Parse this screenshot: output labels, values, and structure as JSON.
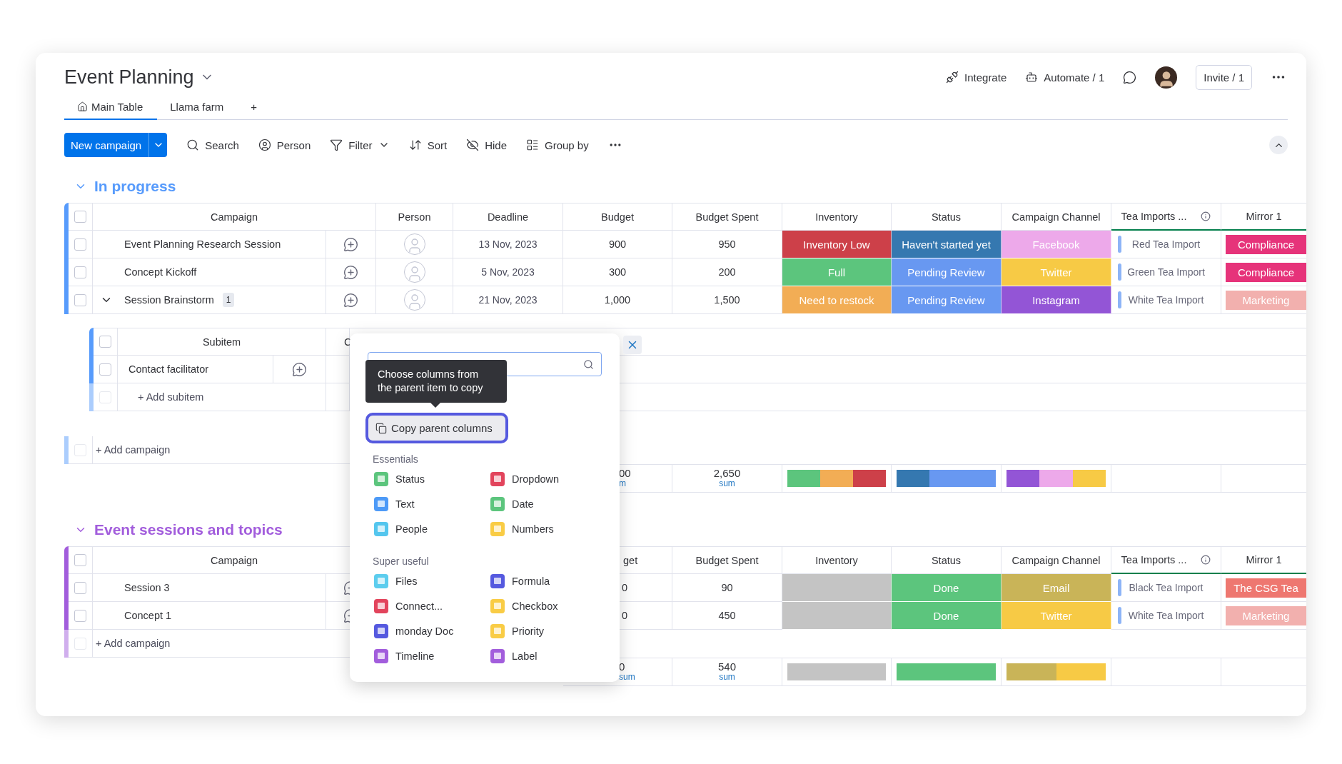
{
  "board": {
    "title": "Event Planning"
  },
  "header_actions": [
    {
      "label": "Integrate",
      "kind": "integrate"
    },
    {
      "label": "Automate / 1",
      "kind": "automate"
    }
  ],
  "invite": "Invite / 1",
  "tabs": [
    {
      "label": "Main Table",
      "selected": true,
      "kind": "home"
    },
    {
      "label": "Llama farm",
      "selected": false
    }
  ],
  "add_tab": "+",
  "toolbar": {
    "primary": "New campaign",
    "items": [
      {
        "label": "Search",
        "kind": "search"
      },
      {
        "label": "Person",
        "kind": "person"
      },
      {
        "label": "Filter",
        "kind": "filter"
      },
      {
        "label": "Sort",
        "kind": "sort"
      },
      {
        "label": "Hide",
        "kind": "hide"
      },
      {
        "label": "Group by",
        "kind": "group"
      }
    ]
  },
  "groups": [
    {
      "title": "In progress",
      "color": "#579bfc",
      "expanded": true,
      "all_checked": false,
      "columns": {
        "campaign": "Campaign",
        "person": "Person",
        "deadline": "Deadline",
        "budget": "Budget",
        "spent": "Budget Spent",
        "inventory": "Inventory",
        "status": "Status",
        "channel": "Campaign Channel",
        "tea": "Tea Imports ...",
        "mirror": "Mirror 1"
      },
      "rows": [
        {
          "name": "Event Planning Research Session",
          "checked": false,
          "person": {
            "assigned": false
          },
          "deadline": "13 Nov, 2023",
          "budget": "900",
          "spent": "950",
          "inventory": {
            "label": "Inventory Low",
            "color": "#cd4049"
          },
          "status": {
            "label": "Haven't started yet",
            "color": "#3578b0"
          },
          "channel": {
            "label": "Facebook",
            "color": "#eda9ea"
          },
          "tea": "Red Tea Import",
          "mirror": {
            "label": "Compliance",
            "color": "#e6337a"
          }
        },
        {
          "name": "Concept Kickoff",
          "checked": false,
          "person": {
            "assigned": false
          },
          "deadline": "5 Nov, 2023",
          "budget": "300",
          "spent": "200",
          "inventory": {
            "label": "Full",
            "color": "#5cc57d"
          },
          "status": {
            "label": "Pending Review",
            "color": "#6898f1"
          },
          "channel": {
            "label": "Twitter",
            "color": "#f7ca45"
          },
          "tea": "Green Tea Import",
          "mirror": {
            "label": "Compliance",
            "color": "#e6337a"
          }
        },
        {
          "name": "Session Brainstorm",
          "checked": false,
          "expanded": true,
          "subitem_count": "1",
          "person": {
            "assigned": false
          },
          "deadline": "21 Nov, 2023",
          "budget": "1,000",
          "spent": "1,500",
          "inventory": {
            "label": "Need to restock",
            "color": "#f2ad55"
          },
          "status": {
            "label": "Pending Review",
            "color": "#6898f1"
          },
          "channel": {
            "label": "Instagram",
            "color": "#9355d6"
          },
          "tea": "White Tea Import",
          "mirror": {
            "label": "Marketing",
            "color": "#f2b0ae"
          },
          "subitems": {
            "all_checked": false,
            "columns": [
              "Subitem",
              "C"
            ],
            "rows": [
              {
                "name": "Contact facilitator",
                "checked": false
              }
            ],
            "add_label": "+ Add subitem"
          }
        }
      ],
      "add_label": "+ Add campaign",
      "summary": {
        "budget": "00",
        "budget_note": "m",
        "spent": "2,650",
        "spent_note": "sum",
        "inventory": [
          {
            "color": "#5cc57d"
          },
          {
            "color": "#f2ad55"
          },
          {
            "color": "#cd4049"
          }
        ],
        "status": [
          {
            "color": "#3578b0"
          },
          {
            "color": "#6898f1"
          },
          {
            "color": "#6898f1"
          }
        ],
        "channel": [
          {
            "color": "#9355d6"
          },
          {
            "color": "#eda9ea"
          },
          {
            "color": "#f7ca45"
          }
        ]
      }
    },
    {
      "title": "Event sessions and topics",
      "color": "#a25ddc",
      "expanded": true,
      "all_checked": false,
      "columns": {
        "campaign": "Campaign",
        "budget": "get",
        "spent": "Budget Spent",
        "inventory": "Inventory",
        "status": "Status",
        "channel": "Campaign Channel",
        "tea": "Tea Imports ...",
        "mirror": "Mirror 1"
      },
      "rows": [
        {
          "name": "Session 3",
          "checked": false,
          "budget": "0",
          "spent": "90",
          "inventory": {
            "color": "#c4c4c4"
          },
          "status": {
            "label": "Done",
            "color": "#5cc57d"
          },
          "channel": {
            "label": "Email",
            "color": "#c9b458"
          },
          "tea": "Black Tea Import",
          "mirror": {
            "label": "The CSG Tea",
            "color": "#ee7770"
          }
        },
        {
          "name": "Concept 1",
          "checked": false,
          "budget": "0",
          "spent": "450",
          "inventory": {
            "color": "#c4c4c4"
          },
          "status": {
            "label": "Done",
            "color": "#5cc57d"
          },
          "channel": {
            "label": "Twitter",
            "color": "#f7ca45"
          },
          "tea": "White Tea Import",
          "mirror": {
            "label": "Marketing",
            "color": "#f2b0ae"
          }
        }
      ],
      "add_label": "+ Add campaign",
      "summary": {
        "budget": "0",
        "budget_note": "sum",
        "spent": "540",
        "spent_note": "sum",
        "inventory": [
          {
            "color": "#c4c4c4"
          }
        ],
        "status": [
          {
            "color": "#5cc57d"
          }
        ],
        "channel": [
          {
            "color": "#c9b458"
          },
          {
            "color": "#f7ca45"
          }
        ]
      }
    }
  ],
  "column_picker": {
    "tooltip": "Choose columns from the parent item to copy",
    "shortcut": "Copy parent columns",
    "sections": [
      {
        "title": "Essentials",
        "items": [
          {
            "label": "Status",
            "color": "#5cc57d"
          },
          {
            "label": "Dropdown",
            "color": "#e2445c"
          },
          {
            "label": "Text",
            "color": "#4d9af7"
          },
          {
            "label": "Date",
            "color": "#5cc57d"
          },
          {
            "label": "People",
            "color": "#54c6ee"
          },
          {
            "label": "Numbers",
            "color": "#f9cc45"
          }
        ]
      },
      {
        "title": "Super useful",
        "items": [
          {
            "label": "Files",
            "color": "#5ccdee"
          },
          {
            "label": "Formula",
            "color": "#5559df"
          },
          {
            "label": "Connect...",
            "color": "#e2445c"
          },
          {
            "label": "Checkbox",
            "color": "#f9cc45"
          },
          {
            "label": "monday Doc",
            "color": "#5559df"
          },
          {
            "label": "Priority",
            "color": "#f9cc45"
          },
          {
            "label": "Timeline",
            "color": "#a25ddc"
          },
          {
            "label": "Label",
            "color": "#a25ddc"
          }
        ]
      }
    ]
  }
}
